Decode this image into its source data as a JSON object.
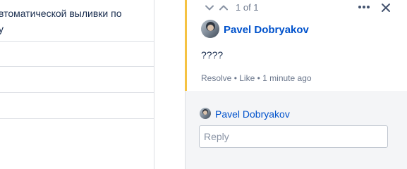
{
  "document": {
    "text_line_1": "втоматической выливки по",
    "text_line_2": "у"
  },
  "comment": {
    "counter": "1 of 1",
    "author": "Pavel Dobryakov",
    "body": "????",
    "actions": {
      "resolve": "Resolve",
      "separator": "•",
      "like": "Like",
      "time": "1 minute ago"
    }
  },
  "reply": {
    "author": "Pavel Dobryakov",
    "placeholder": "Reply",
    "value": ""
  },
  "colors": {
    "accent_link": "#0052cc",
    "active_marker": "#f5c242",
    "panel_bg": "#f4f5f7"
  }
}
